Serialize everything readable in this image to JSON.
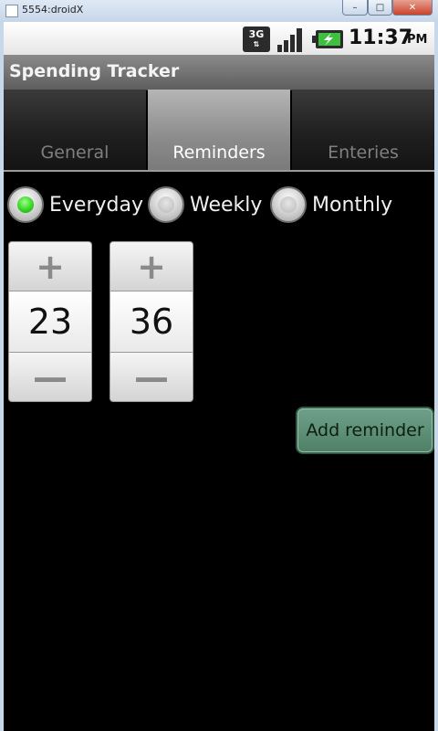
{
  "window": {
    "title": "5554:droidX",
    "minimize_icon": "minimize-icon",
    "maximize_icon": "maximize-icon",
    "close_icon": "close-icon"
  },
  "status_bar": {
    "network": "3G",
    "time": "11:37",
    "ampm": "PM"
  },
  "app": {
    "title": "Spending Tracker"
  },
  "tabs": [
    {
      "label": "General",
      "active": false
    },
    {
      "label": "Reminders",
      "active": true
    },
    {
      "label": "Enteries",
      "active": false
    }
  ],
  "frequency": {
    "options": [
      {
        "label": "Everyday",
        "checked": true
      },
      {
        "label": "Weekly",
        "checked": false
      },
      {
        "label": "Monthly",
        "checked": false
      }
    ]
  },
  "time_picker": {
    "hour": "23",
    "minute": "36"
  },
  "add_reminder_label": "Add reminder",
  "colors": {
    "checked_radio": "#2fd11e",
    "add_button": "#5a8c73",
    "active_tab": "#9a9a9a"
  }
}
